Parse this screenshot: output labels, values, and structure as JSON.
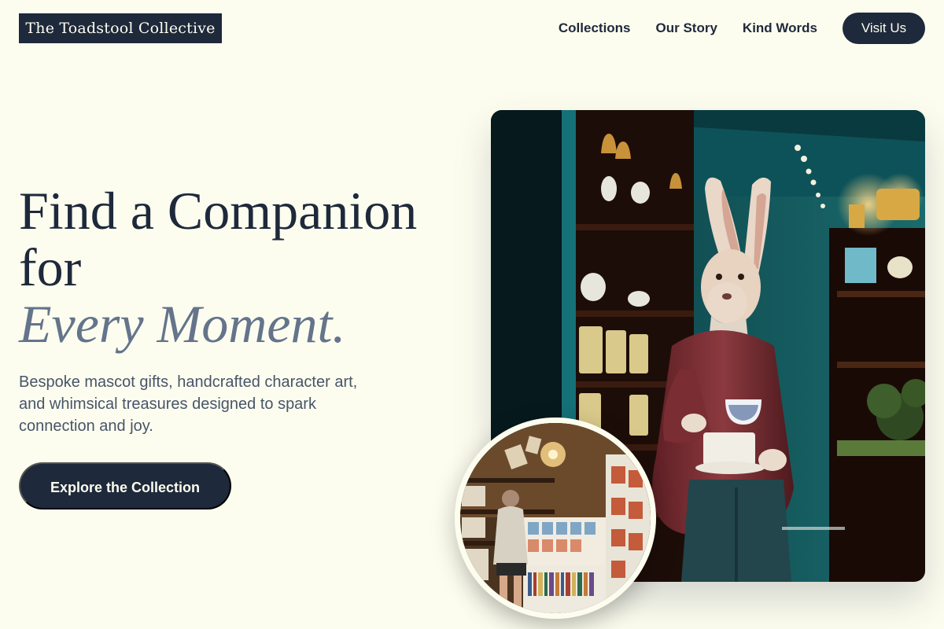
{
  "header": {
    "logo": "The Toadstool Collective",
    "nav": [
      {
        "label": "Collections"
      },
      {
        "label": "Our Story"
      },
      {
        "label": "Kind Words"
      }
    ],
    "visit_label": "Visit Us"
  },
  "hero": {
    "headline_line1": "Find a Companion",
    "headline_line2": "for",
    "headline_accent": "Every Moment.",
    "subtitle": "Bespoke mascot gifts, handcrafted character art, and whimsical treasures designed to spark connection and joy.",
    "cta_label": "Explore the Collection"
  },
  "colors": {
    "background": "#fdfdef",
    "primary": "#1e293b",
    "accent_text": "#64748b"
  }
}
